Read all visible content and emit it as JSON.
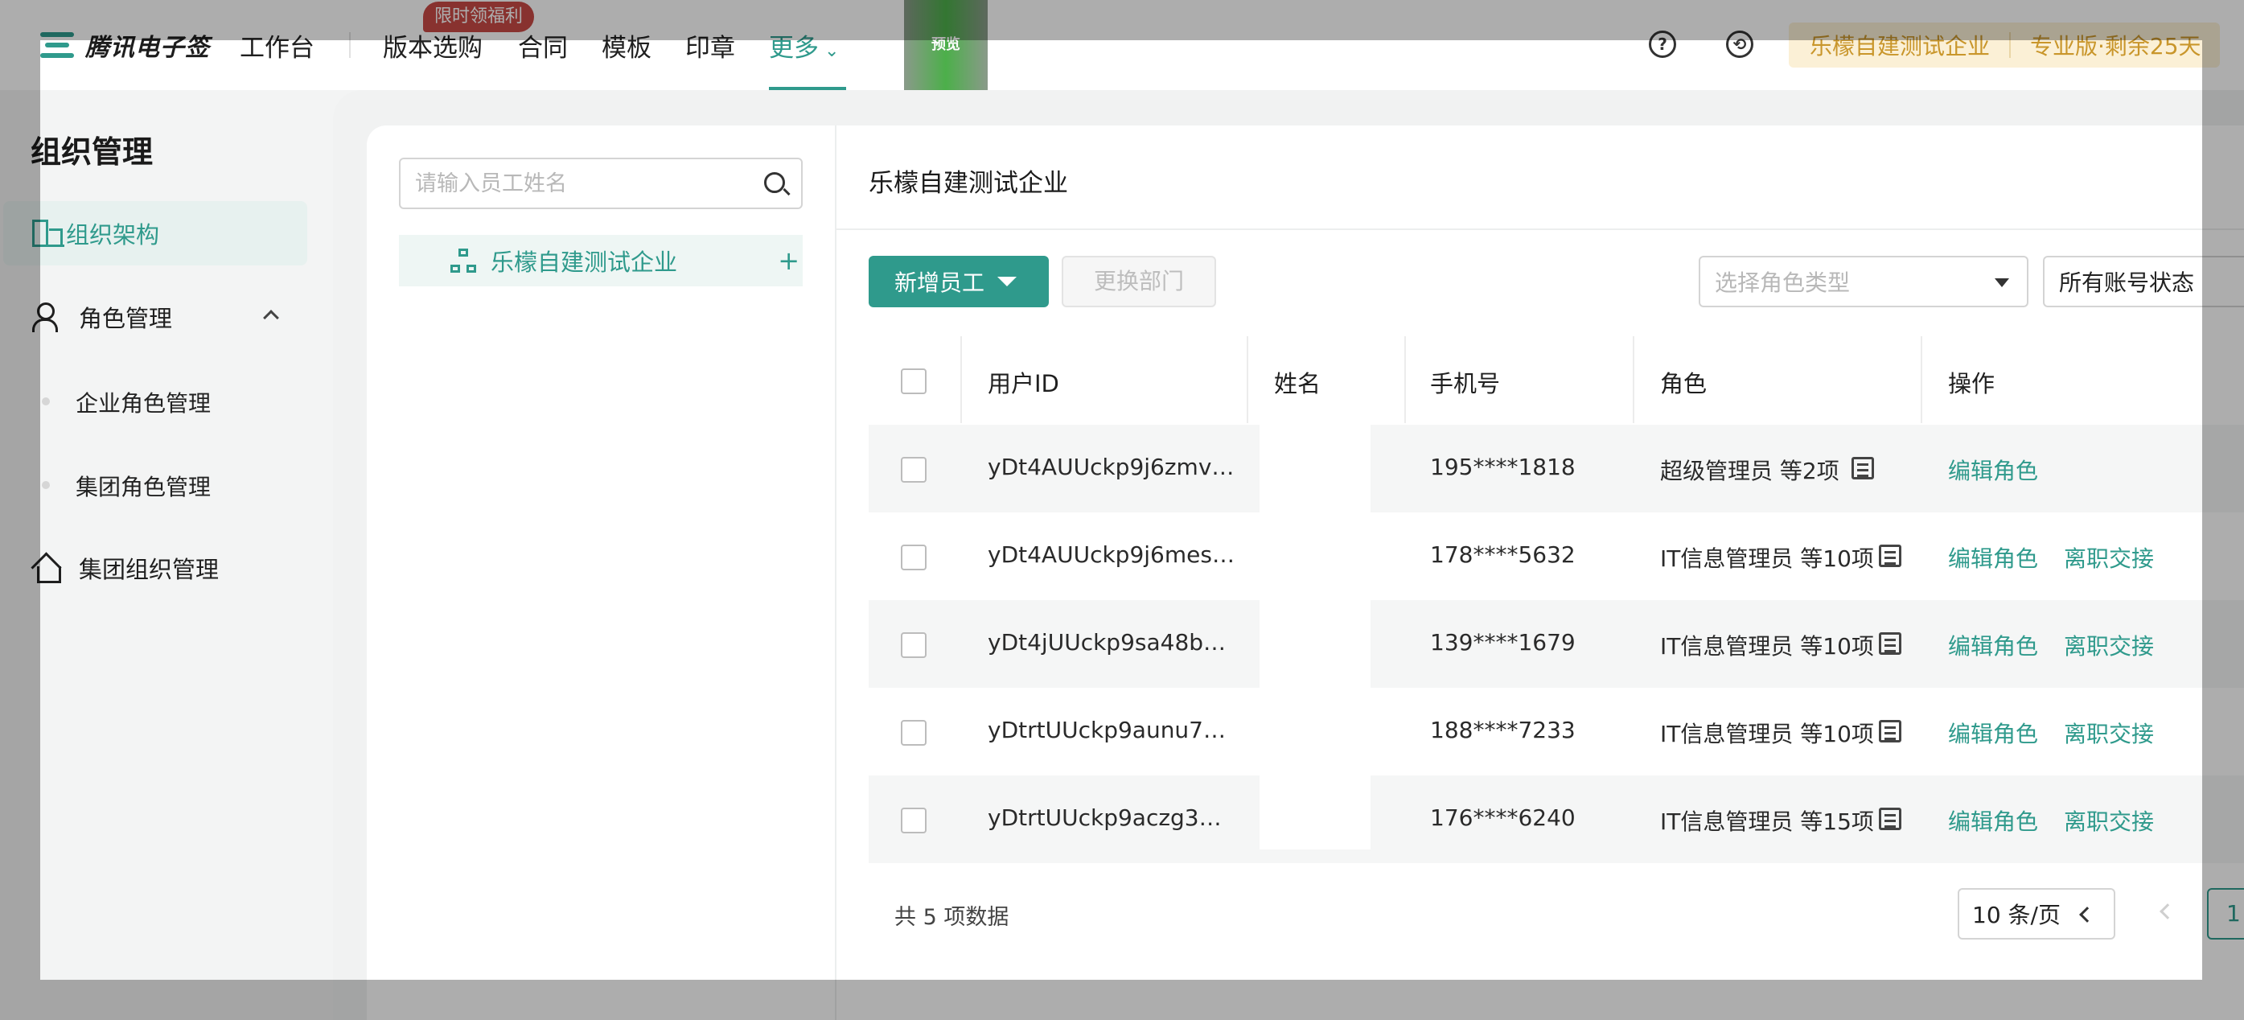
{
  "brand": {
    "name": "腾讯电子签"
  },
  "nav": {
    "items": [
      "工作台",
      "版本选购",
      "合同",
      "模板",
      "印章",
      "更多"
    ],
    "promo_badge": "限时领福利",
    "preview": "预览",
    "help_icon": "?",
    "org_name": "乐檬自建测试企业",
    "plan": "专业版·剩余25天"
  },
  "sidebar": {
    "title": "组织管理",
    "items": [
      {
        "label": "组织架构",
        "icon": "building-icon",
        "active": true
      },
      {
        "label": "角色管理",
        "icon": "role-icon",
        "expanded": true
      },
      {
        "label": "集团组织管理",
        "icon": "group-org-icon"
      }
    ],
    "role_sub": [
      "企业角色管理",
      "集团角色管理"
    ]
  },
  "tree": {
    "search_placeholder": "请输入员工姓名",
    "root": "乐檬自建测试企业",
    "add": "+"
  },
  "main": {
    "title": "乐檬自建测试企业",
    "add_employee": "新增员工",
    "change_dept": "更换部门",
    "role_select_placeholder": "选择角色类型",
    "status_select": "所有账号状态"
  },
  "table": {
    "columns": [
      "用户ID",
      "姓名",
      "手机号",
      "角色",
      "操作"
    ],
    "rows": [
      {
        "id": "yDt4AUUckp9j6zmv…",
        "name": "",
        "phone": "195****1818",
        "role": "超级管理员 等2项",
        "actions": [
          "编辑角色"
        ]
      },
      {
        "id": "yDt4AUUckp9j6mes…",
        "name": "",
        "phone": "178****5632",
        "role": "IT信息管理员 等10项",
        "actions": [
          "编辑角色",
          "离职交接"
        ]
      },
      {
        "id": "yDt4jUUckp9sa48b…",
        "name": "",
        "phone": "139****1679",
        "role": "IT信息管理员 等10项",
        "actions": [
          "编辑角色",
          "离职交接"
        ]
      },
      {
        "id": "yDtrtUUckp9aunu7…",
        "name": "",
        "phone": "188****7233",
        "role": "IT信息管理员 等10项",
        "actions": [
          "编辑角色",
          "离职交接"
        ]
      },
      {
        "id": "yDtrtUUckp9aczg3…",
        "name": "",
        "phone": "176****6240",
        "role": "IT信息管理员 等15项",
        "actions": [
          "编辑角色",
          "离职交接"
        ]
      }
    ]
  },
  "pagination": {
    "total": "共 5 项数据",
    "page_size": "10 条/页",
    "current": "1"
  },
  "colors": {
    "accent": "#2f9a8c",
    "gold": "#c9962b",
    "badge": "#c94a46"
  }
}
